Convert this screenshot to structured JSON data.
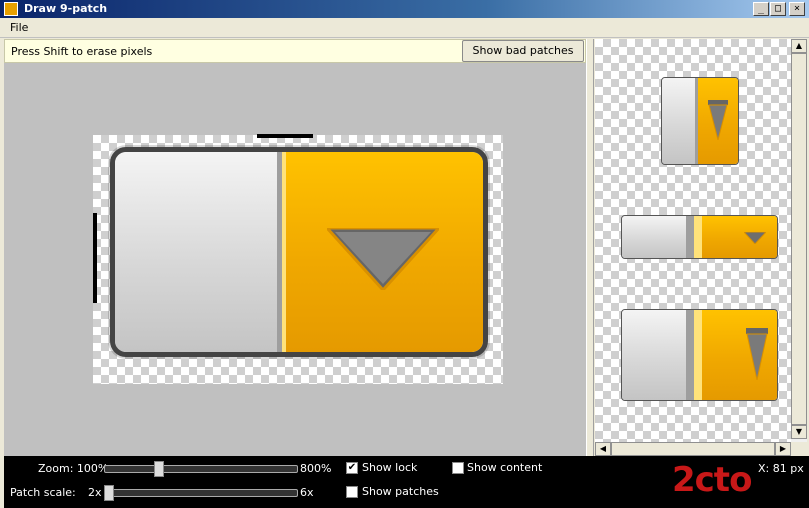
{
  "window": {
    "title": "Draw 9-patch",
    "minimize": "_",
    "maximize": "□",
    "close": "×"
  },
  "menu": {
    "file": "File"
  },
  "toolbar": {
    "hint": "Press Shift to erase pixels",
    "bad_patches_button": "Show bad patches"
  },
  "colors": {
    "accent_orange": "#f0a800",
    "gray_face": "#d8d8d8",
    "patch_marker": "#000000"
  },
  "controls": {
    "zoom_label": "Zoom: 100%",
    "zoom_max": "800%",
    "zoom_value_percent": 100,
    "patch_scale_label": "Patch scale:",
    "patch_min": "2x",
    "patch_max": "6x",
    "show_lock": "Show lock",
    "show_lock_checked": true,
    "show_content": "Show content",
    "show_content_checked": false,
    "show_patches": "Show patches",
    "show_patches_checked": false,
    "coords": "X: 81 px",
    "watermark": "2cto"
  },
  "icons": {
    "arrow_down": "triangle-down-icon",
    "check": "✔",
    "scroll_up": "▲",
    "scroll_down": "▼",
    "scroll_left": "◀",
    "scroll_right": "▶"
  }
}
